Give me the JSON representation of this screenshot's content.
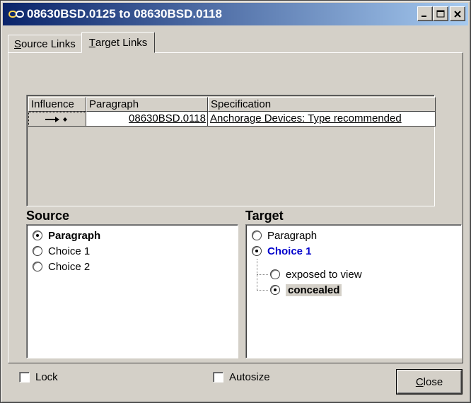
{
  "window": {
    "title": "08630BSD.0125 to 08630BSD.0118",
    "icon": "link-icon",
    "controls": [
      "minimize-icon",
      "maximize-icon",
      "close-icon"
    ]
  },
  "tabs": [
    {
      "mnemonic": "S",
      "rest": "ource Links",
      "active": false
    },
    {
      "mnemonic": "T",
      "rest": "arget Links",
      "active": true
    }
  ],
  "links_table": {
    "columns": [
      "Influence",
      "Paragraph",
      "Specification"
    ],
    "rows": [
      {
        "influence_icon": "arrow-right-diamond-icon",
        "paragraph": "08630BSD.0118",
        "specification": "Anchorage Devices:  Type recommended"
      }
    ]
  },
  "source": {
    "label": "Source",
    "items": [
      {
        "label": "Paragraph",
        "selected": true
      },
      {
        "label": "Choice 1",
        "selected": false
      },
      {
        "label": "Choice 2",
        "selected": false
      }
    ]
  },
  "target": {
    "label": "Target",
    "items": [
      {
        "label": "Paragraph",
        "selected": false
      },
      {
        "label": "Choice 1",
        "selected": true
      },
      {
        "label": "exposed to view",
        "selected": false
      },
      {
        "label": "concealed",
        "selected": true
      }
    ]
  },
  "footer": {
    "lock_label": "Lock",
    "autosize_label": "Autosize",
    "close_mnemonic": "C",
    "close_rest": "lose"
  },
  "colors": {
    "title_gradient_start": "#0a246a",
    "title_gradient_end": "#a6caf0",
    "face": "#d4d0c8",
    "selected_choice": "#0000cc"
  }
}
